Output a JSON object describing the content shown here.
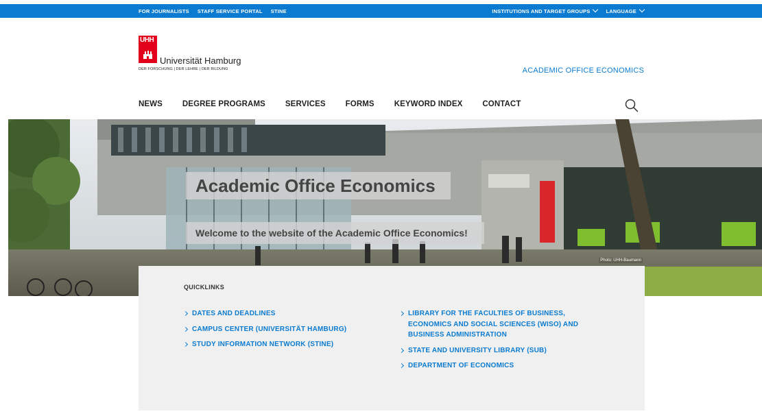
{
  "topbar": {
    "left_links": [
      "FOR JOURNALISTS",
      "STAFF SERVICE PORTAL",
      "STINE"
    ],
    "right_links": [
      "INSTITUTIONS AND TARGET GROUPS",
      "LANGUAGE"
    ]
  },
  "logo": {
    "mark": "UHH",
    "name": "Universität Hamburg",
    "tagline": "DER FORSCHUNG | DER LEHRE | DER BILDUNG"
  },
  "office_link": "ACADEMIC OFFICE ECONOMICS",
  "nav": {
    "items": [
      "NEWS",
      "DEGREE PROGRAMS",
      "SERVICES",
      "FORMS",
      "KEYWORD INDEX",
      "CONTACT"
    ],
    "search_icon": "search-icon"
  },
  "hero": {
    "title": "Academic Office Economics",
    "subtitle": "Welcome to the website of the Academic Office Economics!",
    "photo_credit": "Photo: UHH-Baumann"
  },
  "quicklinks": {
    "heading": "QUICKLINKS",
    "left": [
      "DATES AND DEADLINES",
      "CAMPUS CENTER (UNIVERSITÄT HAMBURG)",
      "STUDY INFORMATION NETWORK (STINE)"
    ],
    "right": [
      "LIBRARY FOR THE FACULTIES OF BUSINESS, ECONOMICS AND SOCIAL SCIENCES (WISO) AND BUSINESS ADMINISTRATION",
      "STATE AND UNIVERSITY LIBRARY (SUB)",
      "DEPARTMENT OF ECONOMICS"
    ]
  },
  "colors": {
    "brand_blue": "#0a7bd0",
    "brand_red": "#e2001a"
  }
}
